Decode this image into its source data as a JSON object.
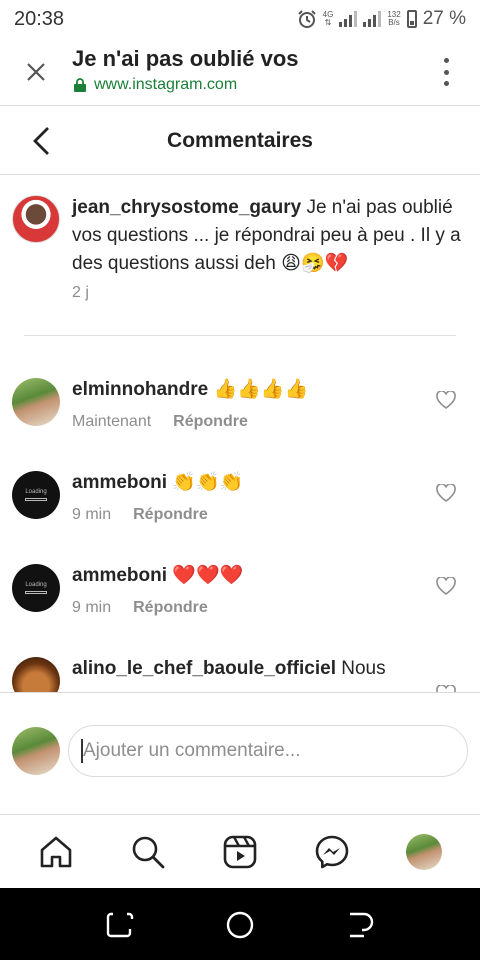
{
  "status_bar": {
    "time": "20:38",
    "network_type": "4G",
    "speed_value": "132",
    "speed_unit": "B/s",
    "battery": "27 %"
  },
  "browser": {
    "title": "Je n'ai pas oublié vos",
    "url": "www.instagram.com",
    "icons": [
      "close-icon",
      "lock-icon",
      "more-vertical-icon"
    ]
  },
  "header": {
    "title": "Commentaires"
  },
  "caption": {
    "username": "jean_chrysostome_gaury",
    "text": " Je n'ai pas oublié vos questions ... je répondrai peu à peu . Il y a des questions aussi deh 😩🤧💔",
    "time": "2 j"
  },
  "comments": [
    {
      "username": "elminnohandre",
      "text": " 👍👍👍👍",
      "time": "Maintenant",
      "reply_label": "Répondre"
    },
    {
      "username": "ammeboni",
      "text": " 👏👏👏",
      "time": "9 min",
      "reply_label": "Répondre"
    },
    {
      "username": "ammeboni",
      "text": " ❤️❤️❤️",
      "time": "9 min",
      "reply_label": "Répondre"
    },
    {
      "username": "alino_le_chef_baoule_officiel",
      "text": " Nous",
      "time": "",
      "reply_label": ""
    }
  ],
  "avatar_loading_text": "Loading",
  "input": {
    "placeholder": "Ajouter un commentaire..."
  },
  "bottom_nav": [
    "home-icon",
    "search-icon",
    "reels-icon",
    "messenger-icon",
    "profile-avatar"
  ],
  "system_nav": [
    "recents-icon",
    "home-circle-icon",
    "back-icon"
  ],
  "colors": {
    "url_green": "#1a7f37",
    "meta_gray": "#8e8e8e",
    "heart_red": "#e0245e"
  }
}
